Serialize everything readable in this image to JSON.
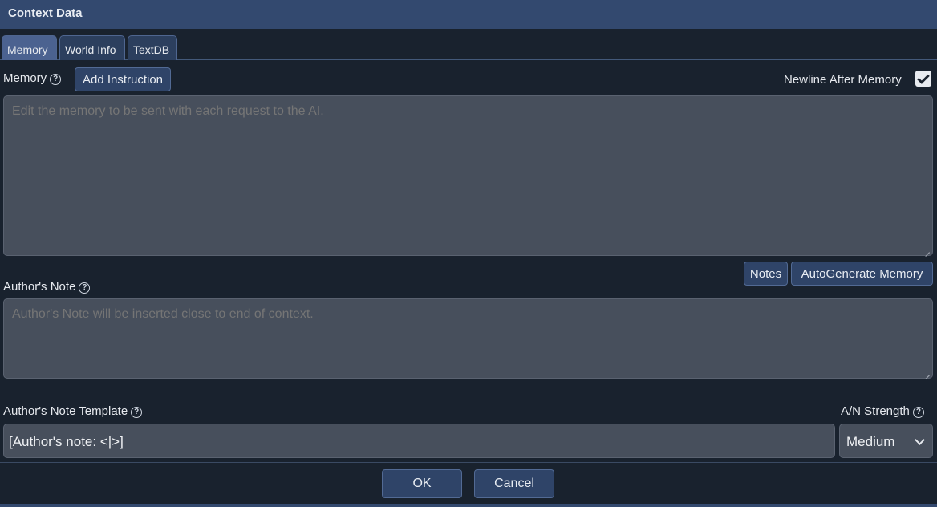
{
  "dialog": {
    "title": "Context Data"
  },
  "tabs": [
    {
      "label": "Memory",
      "active": true
    },
    {
      "label": "World Info",
      "active": false
    },
    {
      "label": "TextDB",
      "active": false
    }
  ],
  "memory": {
    "label": "Memory",
    "add_instruction_label": "Add Instruction",
    "newline_after_label": "Newline After Memory",
    "newline_after_checked": true,
    "placeholder": "Edit the memory to be sent with each request to the AI.",
    "value": ""
  },
  "memory_actions": {
    "notes_label": "Notes",
    "autogenerate_label": "AutoGenerate Memory"
  },
  "authors_note": {
    "label": "Author's Note",
    "placeholder": "Author's Note will be inserted close to end of context.",
    "value": ""
  },
  "an_template": {
    "label": "Author's Note Template",
    "value": "[Author's note: <|>]"
  },
  "an_strength": {
    "label": "A/N Strength",
    "selected": "Medium"
  },
  "footer": {
    "ok_label": "OK",
    "cancel_label": "Cancel"
  },
  "icons": {
    "help": "help-circle-icon",
    "check": "checkmark-icon",
    "dropdown": "chevron-down-icon"
  },
  "colors": {
    "background": "#19222e",
    "titlebar": "#33496f",
    "button": "#2f4468",
    "field": "#474f5c"
  }
}
